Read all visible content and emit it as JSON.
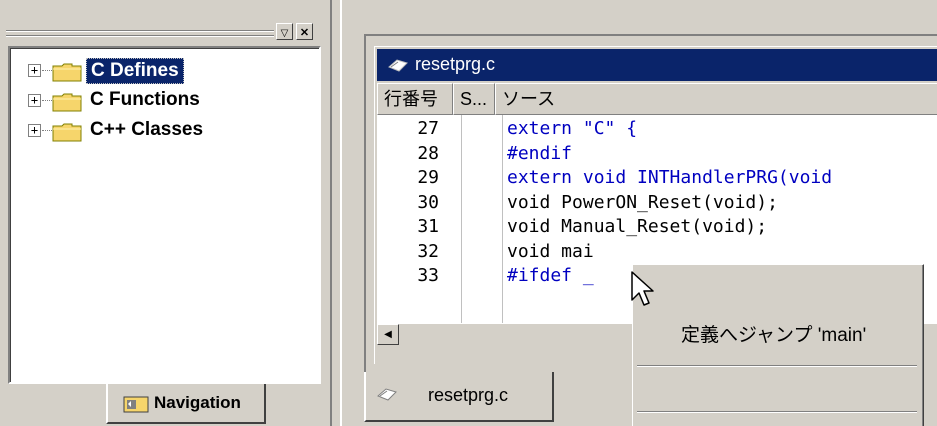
{
  "nav_pane": {
    "toolbar": {
      "menu_glyph": "▽",
      "close_glyph": "✕"
    },
    "tree": [
      {
        "label": "C Defines",
        "expander": "+",
        "selected": true
      },
      {
        "label": "C Functions",
        "expander": "+",
        "selected": false
      },
      {
        "label": "C++ Classes",
        "expander": "+",
        "selected": false
      }
    ],
    "tab_label": "Navigation"
  },
  "editor": {
    "title": "resetprg.c",
    "columns": [
      "行番号",
      "S...",
      "ソース"
    ],
    "lines": [
      {
        "num": "27",
        "code": "extern \"C\" {",
        "keyword": ""
      },
      {
        "num": "28",
        "code": "#endif",
        "keyword": ""
      },
      {
        "num": "29",
        "code": "extern void INTHandlerPRG(void",
        "keyword": ""
      },
      {
        "num": "30",
        "code": "void PowerON_Reset(void);",
        "keyword": ""
      },
      {
        "num": "31",
        "code": "void Manual_Reset(void);",
        "keyword": ""
      },
      {
        "num": "32",
        "code": "void mai",
        "keyword": ""
      },
      {
        "num": "33",
        "code": "#ifdef _",
        "keyword": ""
      }
    ],
    "tab_label": "resetprg.c"
  },
  "context_menu": {
    "items": [
      {
        "label": "定義へジャンプ 'main'"
      }
    ]
  },
  "colors": {
    "title_bar": "#0a246a",
    "keyword": "#0000c0",
    "selection": "#0a246a",
    "folder": "#f6d56b"
  },
  "icons": [
    "folder-icon",
    "expand-plus-icon",
    "file-icon",
    "arrow-left-icon",
    "mouse-cursor-icon"
  ]
}
